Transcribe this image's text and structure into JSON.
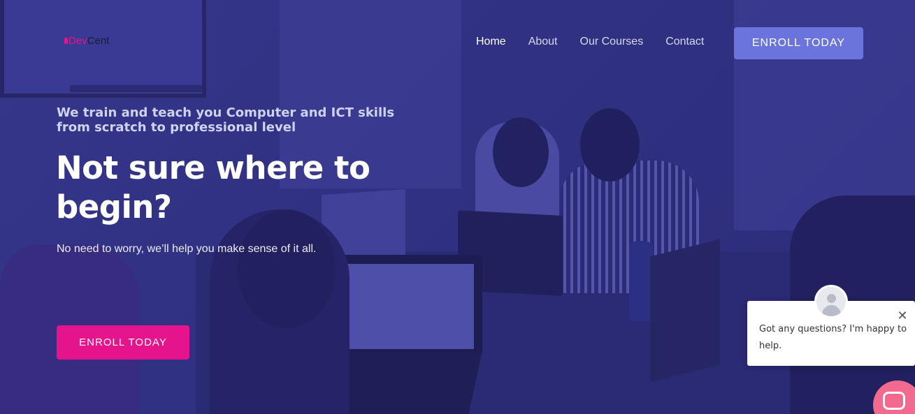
{
  "brand": {
    "name_part1": "Dev",
    "name_part2": "Cent"
  },
  "nav": {
    "items": [
      {
        "label": "Home",
        "active": true
      },
      {
        "label": "About"
      },
      {
        "label": "Our Courses"
      },
      {
        "label": "Contact"
      }
    ],
    "cta_label": "ENROLL TODAY"
  },
  "hero": {
    "subtitle": "We train and teach you Computer and ICT skills from scratch to professional level",
    "title": "Not sure where to begin?",
    "text": "No need to worry, we’ll help you make sense of it all.",
    "cta_label": "ENROLL TODAY"
  },
  "chat": {
    "message": "Got any questions? I'm happy to help.",
    "close_icon": "close-icon",
    "launcher_icon": "chat-bubble-icon"
  },
  "colors": {
    "accent_pink": "#e4148c",
    "accent_blue": "#6b74dc",
    "overlay": "#2f2f7a",
    "chat_launcher": "#f26a8d"
  }
}
